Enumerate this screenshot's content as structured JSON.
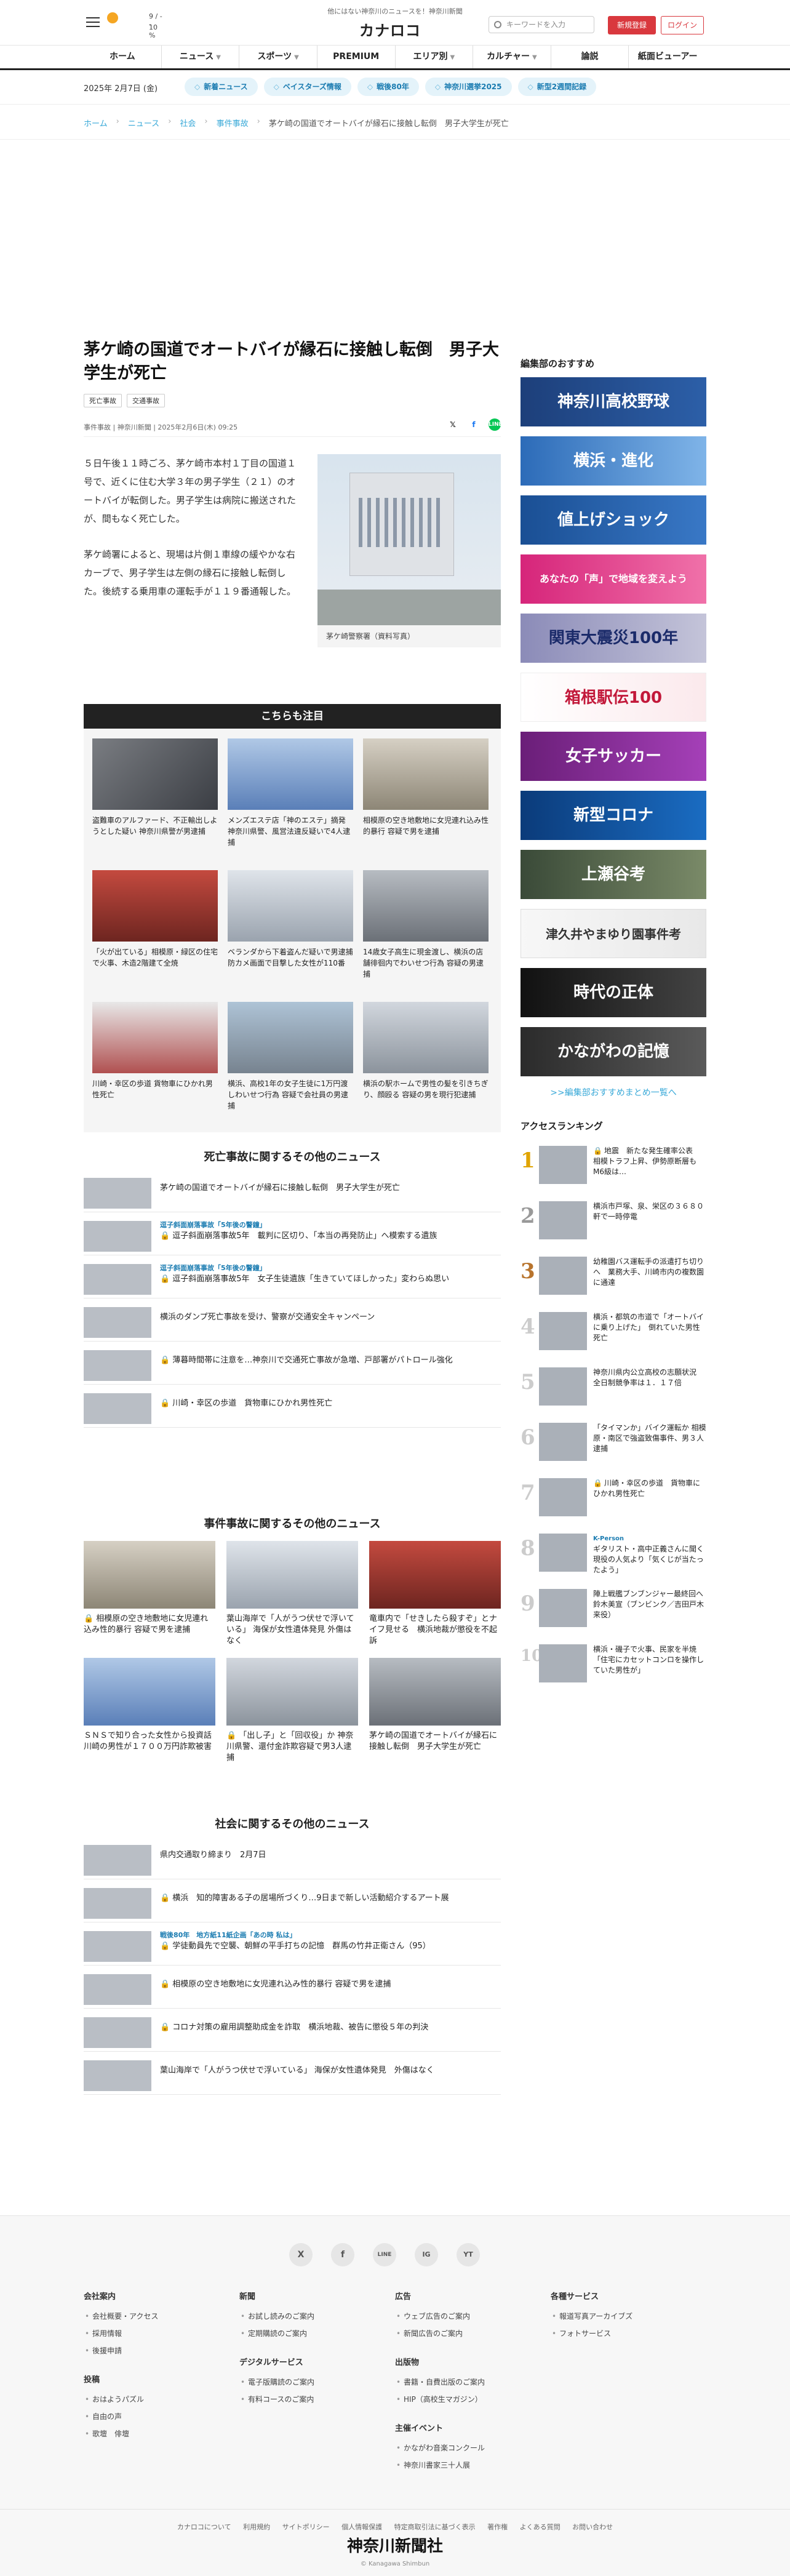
{
  "header": {
    "tagline": "他にはない神奈川のニュースを！神奈川新聞",
    "weather": {
      "temp_high": "9 / --",
      "temp_low": "10 %"
    },
    "logo_text": "カナロコ",
    "search_placeholder": "キーワードを入力",
    "register_label": "新規登録",
    "login_label": "ログイン"
  },
  "nav": [
    "ホーム",
    "ニュース",
    "スポーツ",
    "PREMIUM",
    "エリア別",
    "カルチャー",
    "論説",
    "紙面ビューアー"
  ],
  "date": "2025年 2月7日 (金)",
  "trends": [
    "新着ニュース",
    "ベイスターズ情報",
    "戦後80年",
    "神奈川選挙2025",
    "新型2週間記録"
  ],
  "breadcrumb": [
    "ホーム",
    "ニュース",
    "社会",
    "事件事故",
    "茅ケ崎の国道でオートバイが縁石に接触し転倒　男子大学生が死亡"
  ],
  "article": {
    "title": "茅ケ崎の国道でオートバイが縁石に接触し転倒　男子大学生が死亡",
    "tags": [
      "死亡事故",
      "交通事故"
    ],
    "meta": "事件事故 | 神奈川新聞 | 2025年2月6日(木) 09:25",
    "paragraphs": [
      "５日午後１１時ごろ、茅ケ崎市本村１丁目の国道１号で、近くに住む大学３年の男子学生（２１）のオートバイが転倒した。男子学生は病院に搬送されたが、間もなく死亡した。",
      "茅ケ崎署によると、現場は片側１車線の緩やかな右カーブで、男子学生は左側の縁石に接触し転倒した。後続する乗用車の運転手が１１９番通報した。"
    ],
    "photo_caption": "茅ケ崎警察署（資料写真）"
  },
  "attention": {
    "heading": "こちらも注目",
    "items": [
      "盗難車のアルファード、不正輸出しようとした疑い 神奈川県警が男逮捕",
      "メンズエステ店「神のエステ」摘発 神奈川県警、風営法違反疑いで4人逮捕",
      "相模原の空き地敷地に女児連れ込み性的暴行 容疑で男を逮捕",
      "「火が出ている」相模原・緑区の住宅で火事、木造2階建て全焼",
      "ベランダから下着盗んだ疑いで男逮捕 防カメ画面で目撃した女性が110番",
      "14歳女子高生に現金渡し、横浜の店舗徘徊内でわいせつ行為 容疑の男逮捕",
      "川崎・幸区の歩道 貨物車にひかれ男性死亡",
      "横浜、高校1年の女子生徒に1万円渡しわいせつ行為 容疑で会社員の男逮捕",
      "横浜の駅ホームで男性の髪を引きちぎり、顔殴る 容疑の男を現行犯逮捕"
    ]
  },
  "death_news": {
    "heading": "死亡事故に関するその他のニュース",
    "items": [
      {
        "kicker": "",
        "text": "茅ケ崎の国道でオートバイが縁石に接触し転倒　男子大学生が死亡",
        "premium": false
      },
      {
        "kicker": "逗子斜面崩落事故「5年後の警鐘」",
        "text": "逗子斜面崩落事故5年　載判に区切り、「本当の再発防止」へ模索する遺族",
        "premium": true
      },
      {
        "kicker": "逗子斜面崩落事故「5年後の警鐘」",
        "text": "逗子斜面崩落事故5年　女子生徒遺族「生きていてほしかった」変わらぬ思い",
        "premium": true
      },
      {
        "kicker": "",
        "text": "横浜のダンプ死亡事故を受け、警察が交通安全キャンペーン",
        "premium": false
      },
      {
        "kicker": "",
        "text": "薄暮時間帯に注意を…神奈川で交通死亡事故が急増、戸部署がパトロール強化",
        "premium": true
      },
      {
        "kicker": "",
        "text": "川崎・幸区の歩道　貨物車にひかれ男性死亡",
        "premium": true
      }
    ]
  },
  "incident_news": {
    "heading": "事件事故に関するその他のニュース",
    "items": [
      {
        "text": "相模原の空き地敷地に女児連れ込み性的暴行 容疑で男を逮捕",
        "premium": true
      },
      {
        "text": "葉山海岸で「人がうつ伏せで浮いている」 海保が女性遺体発見 外傷はなく",
        "premium": false
      },
      {
        "text": "竜車内で「せきしたら殺すぞ」とナイフ見せる　横浜地裁が懲役を不起訴",
        "premium": false
      },
      {
        "text": "ＳＮＳで知り合った女性から投資話　川崎の男性が１７００万円詐欺被害",
        "premium": false
      },
      {
        "text": "「出し子」と「回収役」か 神奈川県警、還付金詐欺容疑で男3人逮捕",
        "premium": true
      },
      {
        "text": "茅ケ崎の国道でオートバイが縁石に接触し転倒　男子大学生が死亡",
        "premium": false
      }
    ]
  },
  "society_news": {
    "heading": "社会に関するその他のニュース",
    "items": [
      {
        "kicker": "",
        "text": "県内交通取り締まり　2月7日",
        "premium": false
      },
      {
        "kicker": "",
        "text": "横浜　知的障害ある子の居場所づくり…9日まで新しい活動紹介するアート展",
        "premium": true
      },
      {
        "kicker": "戦後80年　地方紙11紙企画「あの時 私は」",
        "text": "学徒動員先で空襲、朝鮮の平手打ちの記憶　群馬の竹井正衛さん（95）",
        "premium": true
      },
      {
        "kicker": "",
        "text": "相模原の空き地敷地に女児連れ込み性的暴行 容疑で男を逮捕",
        "premium": true
      },
      {
        "kicker": "",
        "text": "コロナ対策の雇用調整助成金を詐取　横浜地裁、被告に懲役５年の判決",
        "premium": true
      },
      {
        "kicker": "",
        "text": "葉山海岸で「人がうつ伏せで浮いている」 海保が女性遺体発見　外傷はなく",
        "premium": false
      }
    ]
  },
  "sidebar": {
    "recommend_heading": "編集部のおすすめ",
    "banners": [
      "神奈川高校野球",
      "横浜・進化",
      "値上げショック",
      "あなたの「声」で地域を変えよう",
      "関東大震災100年",
      "箱根駅伝100",
      "女子サッカー",
      "新型コロナ",
      "上瀬谷考",
      "津久井やまゆり園事件考",
      "時代の正体",
      "かながわの記憶"
    ],
    "more_link": ">>編集部おすすめまとめ一覧へ",
    "ranking_heading": "アクセスランキング",
    "ranking": [
      {
        "kicker": "",
        "text": "地震　新たな発生確率公表　相模トラフ上昇、伊勢原断層も　M6級は…",
        "premium": true
      },
      {
        "kicker": "",
        "text": "横浜市戸塚、泉、栄区の３６８０軒で一時停電",
        "premium": false
      },
      {
        "kicker": "",
        "text": "幼稚園バス運転手の派遣打ち切りへ　業務大手、川崎市内の複数園に通達",
        "premium": false
      },
      {
        "kicker": "",
        "text": "横浜・都筑の市道で「オートバイに乗り上げた」　倒れていた男性死亡",
        "premium": false
      },
      {
        "kicker": "",
        "text": "神奈川県内公立高校の志願状況　全日制競争率は１．１７倍",
        "premium": false
      },
      {
        "kicker": "",
        "text": "「タイマンか」バイク運転か 相模原・南区で強盗致傷事件、男３人逮捕",
        "premium": false
      },
      {
        "kicker": "",
        "text": "川崎・幸区の歩道　貨物車にひかれ男性死亡",
        "premium": true
      },
      {
        "kicker": "K-Person",
        "text": "ギタリスト・高中正義さんに聞く　現役の人気より「気くじが当たったよう」",
        "premium": false
      },
      {
        "kicker": "",
        "text": "陣上戦艦ブンブンジャー最終回へ　鈴木美宣（ブンビンク／吉田戸木来役）",
        "premium": false
      },
      {
        "kicker": "",
        "text": "横浜・磯子で火事、民家を半焼「住宅にカセットコンロを操作していた男性が」",
        "premium": false
      }
    ]
  },
  "footer": {
    "social": [
      "X",
      "f",
      "LINE",
      "IG",
      "YT"
    ],
    "columns": [
      [
        {
          "heading": "会社案内",
          "items": [
            "会社概要・アクセス",
            "採用情報",
            "後援申請"
          ]
        },
        {
          "heading": "投稿",
          "items": [
            "おはようパズル",
            "自由の声",
            "歌壇　俳壇"
          ]
        }
      ],
      [
        {
          "heading": "新聞",
          "items": [
            "お試し読みのご案内",
            "定期購読のご案内"
          ]
        },
        {
          "heading": "デジタルサービス",
          "items": [
            "電子版購読のご案内",
            "有料コースのご案内"
          ]
        }
      ],
      [
        {
          "heading": "広告",
          "items": [
            "ウェブ広告のご案内",
            "新聞広告のご案内"
          ]
        },
        {
          "heading": "出版物",
          "items": [
            "書籍・自費出版のご案内",
            "HIP（高校生マガジン）"
          ]
        },
        {
          "heading": "主催イベント",
          "items": [
            "かながわ音楽コンクール",
            "神奈川書家三十人展"
          ]
        }
      ],
      [
        {
          "heading": "各種サービス",
          "items": [
            "報道写真アーカイブズ",
            "フォトサービス"
          ]
        }
      ]
    ],
    "links": [
      "カナロコについて",
      "利用規約",
      "サイトポリシー",
      "個人情報保護",
      "特定商取引法に基づく表示",
      "著作権",
      "よくある質問",
      "お問い合わせ"
    ],
    "brand": "神奈川新聞社",
    "copyright": "© Kanagawa Shimbun"
  }
}
